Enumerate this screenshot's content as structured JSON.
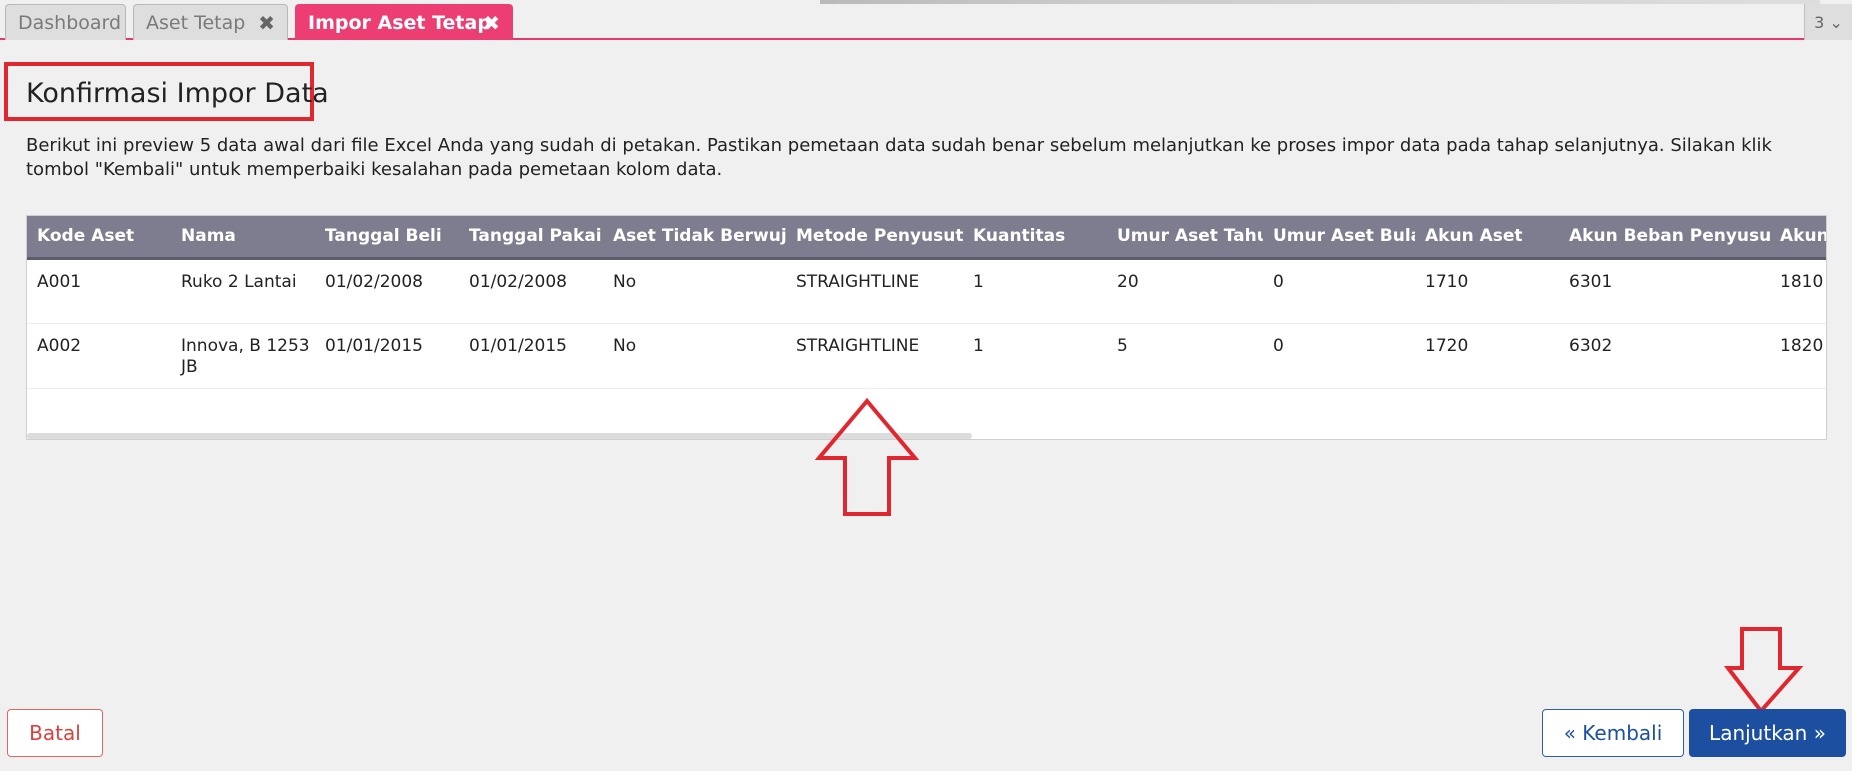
{
  "tabs": [
    {
      "label": "Dashboard",
      "closable": false,
      "active": false
    },
    {
      "label": "Aset Tetap",
      "closable": true,
      "active": false
    },
    {
      "label": "Impor Aset Tetap",
      "closable": true,
      "active": true
    }
  ],
  "tab_count": "3",
  "close_glyph": "✖",
  "dropdown_glyph": "⌄",
  "page_title": "Konfirmasi Impor Data",
  "description": "Berikut ini preview 5 data awal dari file Excel Anda yang sudah di petakan. Pastikan pemetaan data sudah benar sebelum melanjutkan ke proses impor data pada tahap selanjutnya. Silakan klik tombol \"Kembali\" untuk memperbaiki kesalahan pada pemetaan kolom data.",
  "table": {
    "columns": [
      "Kode Aset",
      "Nama",
      "Tanggal Beli",
      "Tanggal Pakai",
      "Aset Tidak Berwujud",
      "Metode Penyusutan",
      "Kuantitas",
      "Umur Aset Tahun",
      "Umur Aset Bulan",
      "Akun Aset",
      "Akun Beban Penyusutan",
      "Akun"
    ],
    "rows": [
      [
        "A001",
        "Ruko 2 Lantai",
        "01/02/2008",
        "01/02/2008",
        "No",
        "STRAIGHTLINE",
        "1",
        "20",
        "0",
        "1710",
        "6301",
        "1810"
      ],
      [
        "A002",
        "Innova, B 1253 JB",
        "01/01/2015",
        "01/01/2015",
        "No",
        "STRAIGHTLINE",
        "1",
        "5",
        "0",
        "1720",
        "6302",
        "1820"
      ]
    ]
  },
  "buttons": {
    "batal": "Batal",
    "kembali": "« Kembali",
    "lanjutkan": "Lanjutkan »"
  },
  "colors": {
    "accent_tab": "#ec3e73",
    "annotation_red": "#e0262f",
    "primary_button": "#1d4fa0",
    "table_header": "#7d7d8f"
  },
  "annotations": [
    "up-arrow-icon",
    "down-arrow-icon"
  ]
}
